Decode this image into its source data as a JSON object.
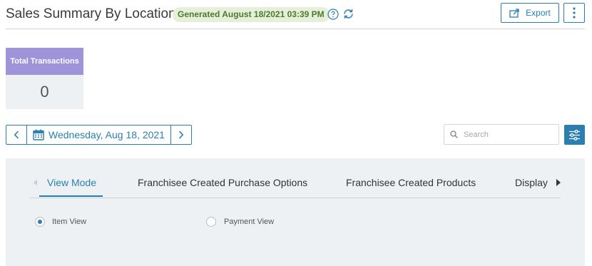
{
  "header": {
    "title": "Sales Summary By Location",
    "generated_badge": "Generated August 18/2021 03:39 PM",
    "export_label": "Export"
  },
  "stat_card": {
    "label": "Total Transactions",
    "value": "0"
  },
  "date_nav": {
    "date": "Wednesday, Aug 18, 2021"
  },
  "search": {
    "placeholder": "Search"
  },
  "tabs": [
    {
      "label": "View Mode",
      "active": true
    },
    {
      "label": "Franchisee Created Purchase Options",
      "active": false
    },
    {
      "label": "Franchisee Created Products",
      "active": false
    },
    {
      "label": "Display",
      "active": false
    }
  ],
  "view_options": [
    {
      "label": "Item View",
      "checked": true
    },
    {
      "label": "Payment View",
      "checked": false
    }
  ],
  "colors": {
    "accent": "#2a7fb0",
    "stat_card": "#9f93d9",
    "badge_bg": "#e6efd9",
    "badge_text": "#4b7a2e",
    "panel_bg": "#eef1f3"
  },
  "icons": [
    "help-icon",
    "refresh-icon",
    "export-icon",
    "more-vertical-icon",
    "chevron-left-icon",
    "calendar-icon",
    "chevron-right-icon",
    "search-icon",
    "filter-sliders-icon",
    "tab-scroll-left-icon",
    "tab-scroll-right-icon"
  ]
}
